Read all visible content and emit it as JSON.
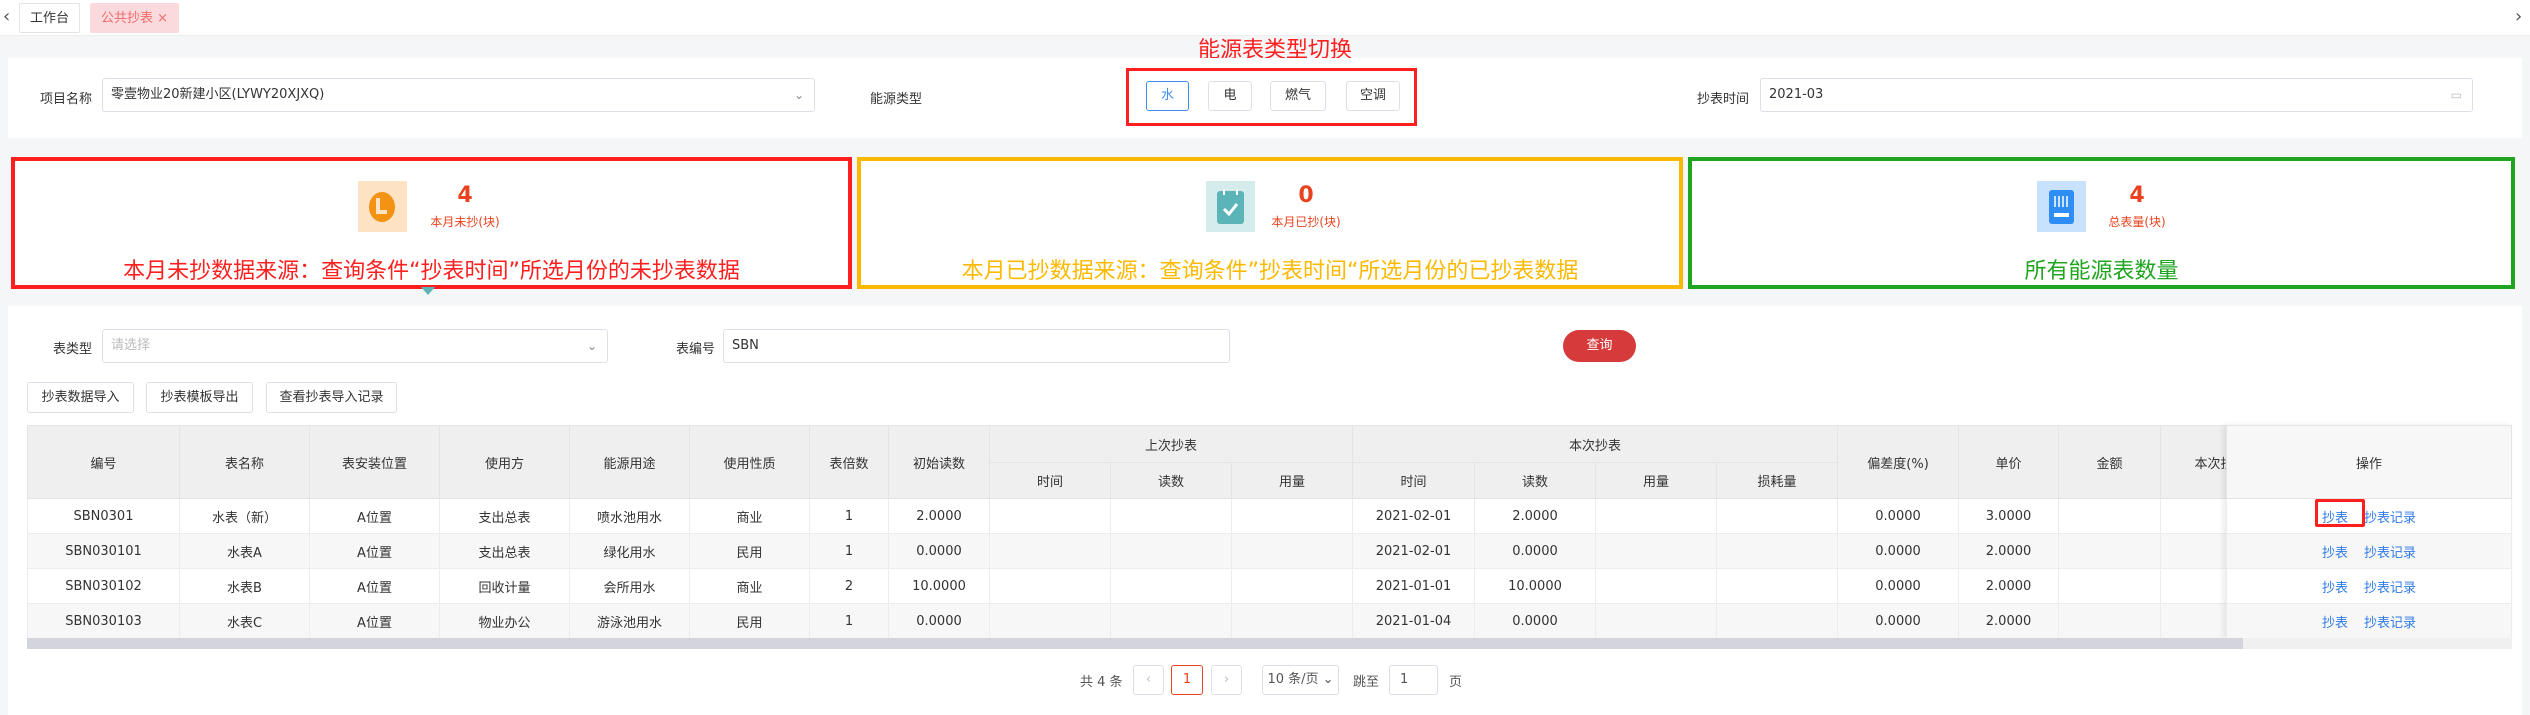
{
  "tabs": [
    {
      "label": "工作台"
    },
    {
      "label": "公共抄表",
      "close": "×"
    }
  ],
  "filters": {
    "project_label": "项目名称",
    "project_value": "零壹物业20新建小区(LYWY20XJXQ)",
    "energy_label": "能源类型",
    "energy_types": [
      "水",
      "电",
      "燃气",
      "空调"
    ],
    "energy_selected": "水",
    "annotation": "能源表类型切换",
    "time_label": "抄表时间",
    "time_value": "2021-03"
  },
  "cards": [
    {
      "value": "4",
      "label": "本月未抄(块)",
      "note": "本月未抄数据来源：查询条件“抄表时间”所选月份的未抄表数据",
      "color": "#ff1f1f",
      "icon": "clock-icon"
    },
    {
      "value": "0",
      "label": "本月已抄(块)",
      "note": "本月已抄数据来源：查询条件”抄表时间“所选月份的已抄表数据",
      "color": "#fdb900",
      "icon": "clipboard-check-icon"
    },
    {
      "value": "4",
      "label": "总表量(块)",
      "note": "所有能源表数量",
      "color": "#1fa51f",
      "icon": "meter-icon"
    }
  ],
  "search": {
    "type_label": "表类型",
    "type_placeholder": "请选择",
    "code_label": "表编号",
    "code_value": "SBN",
    "query": "查询"
  },
  "actions": [
    "抄表数据导入",
    "抄表模板导出",
    "查看抄表导入记录"
  ],
  "table": {
    "headers": [
      "编号",
      "表名称",
      "表安装位置",
      "使用方",
      "能源用途",
      "使用性质",
      "表倍数",
      "初始读数"
    ],
    "group_last": "上次抄表",
    "group_cur": "本次抄表",
    "last_cols": [
      "时间",
      "读数",
      "用量"
    ],
    "cur_cols": [
      "时间",
      "读数",
      "用量",
      "损耗量"
    ],
    "tail_headers": [
      "偏差度(%)",
      "单价",
      "金额",
      "本次抄表"
    ],
    "op_header": "操作",
    "op_links": [
      "抄表",
      "抄表记录"
    ],
    "rows": [
      [
        "SBN0301",
        "水表（新）",
        "A位置",
        "支出总表",
        "喷水池用水",
        "商业",
        "1",
        "2.0000",
        "",
        "",
        "",
        "2021-02-01",
        "2.0000",
        "",
        "",
        "0.0000",
        "3.0000",
        "",
        ""
      ],
      [
        "SBN030101",
        "水表A",
        "A位置",
        "支出总表",
        "绿化用水",
        "民用",
        "1",
        "0.0000",
        "",
        "",
        "",
        "2021-02-01",
        "0.0000",
        "",
        "",
        "0.0000",
        "2.0000",
        "",
        ""
      ],
      [
        "SBN030102",
        "水表B",
        "A位置",
        "回收计量",
        "会所用水",
        "商业",
        "2",
        "10.0000",
        "",
        "",
        "",
        "2021-01-01",
        "10.0000",
        "",
        "",
        "0.0000",
        "2.0000",
        "",
        ""
      ],
      [
        "SBN030103",
        "水表C",
        "A位置",
        "物业办公",
        "游泳池用水",
        "民用",
        "1",
        "0.0000",
        "",
        "",
        "",
        "2021-01-04",
        "0.0000",
        "",
        "",
        "0.0000",
        "2.0000",
        "",
        ""
      ]
    ]
  },
  "pagination": {
    "total": "共 4 条",
    "prev": "‹",
    "page": "1",
    "next": "›",
    "size": "10 条/页",
    "jump": "跳至",
    "jump_value": "1",
    "page_suffix": "页"
  }
}
